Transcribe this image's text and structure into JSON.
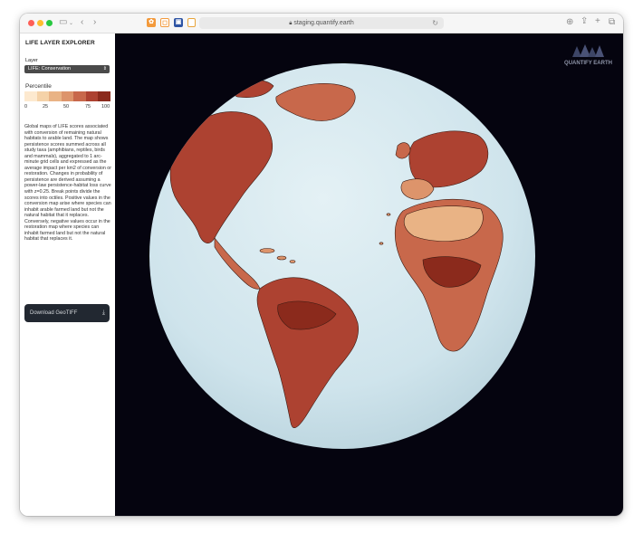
{
  "browser": {
    "url": "staging.quantify.earth",
    "icons": [
      "sidebar-toggle-icon",
      "back-icon",
      "forward-icon",
      "lock-icon",
      "reload-icon",
      "download-icon",
      "share-icon",
      "new-tab-icon",
      "tabs-overview-icon"
    ]
  },
  "sidebar": {
    "title": "LIFE LAYER EXPLORER",
    "layer_label": "Layer",
    "layer_value": "LIFE: Conservation",
    "percentile_label": "Percentile",
    "legend_colors": [
      "#fde9cf",
      "#f5d2a8",
      "#e9b385",
      "#dd946b",
      "#c8684b",
      "#ad4231",
      "#8b2a1c"
    ],
    "ticks": [
      "0",
      "25",
      "50",
      "75",
      "100"
    ],
    "description": "Global maps of LIFE scores associated with conversion of remaining natural habitats to arable land. The map shows persistence scores summed across all study taxa (amphibians, reptiles, birds and mammals), aggregated to 1 arc-minute grid cells and expressed as the average impact per km2 of conversion or restoration. Changes in probability of persistence are derived assuming a power-law persistence-habitat loss curve with z=0.25. Break points divide the scores into octiles. Positive values in the conversion map arise where species can inhabit arable farmed land but not the natural habitat that it replaces. Conversely, negative values occur in the restoration map where species can inhabit farmed land but not the natural habitat that replaces it.",
    "download_label": "Download GeoTIFF"
  },
  "map": {
    "logo_text": "QUANTIFY EARTH",
    "ocean_color": "#d6e9ef",
    "background_color": "#05040f"
  }
}
